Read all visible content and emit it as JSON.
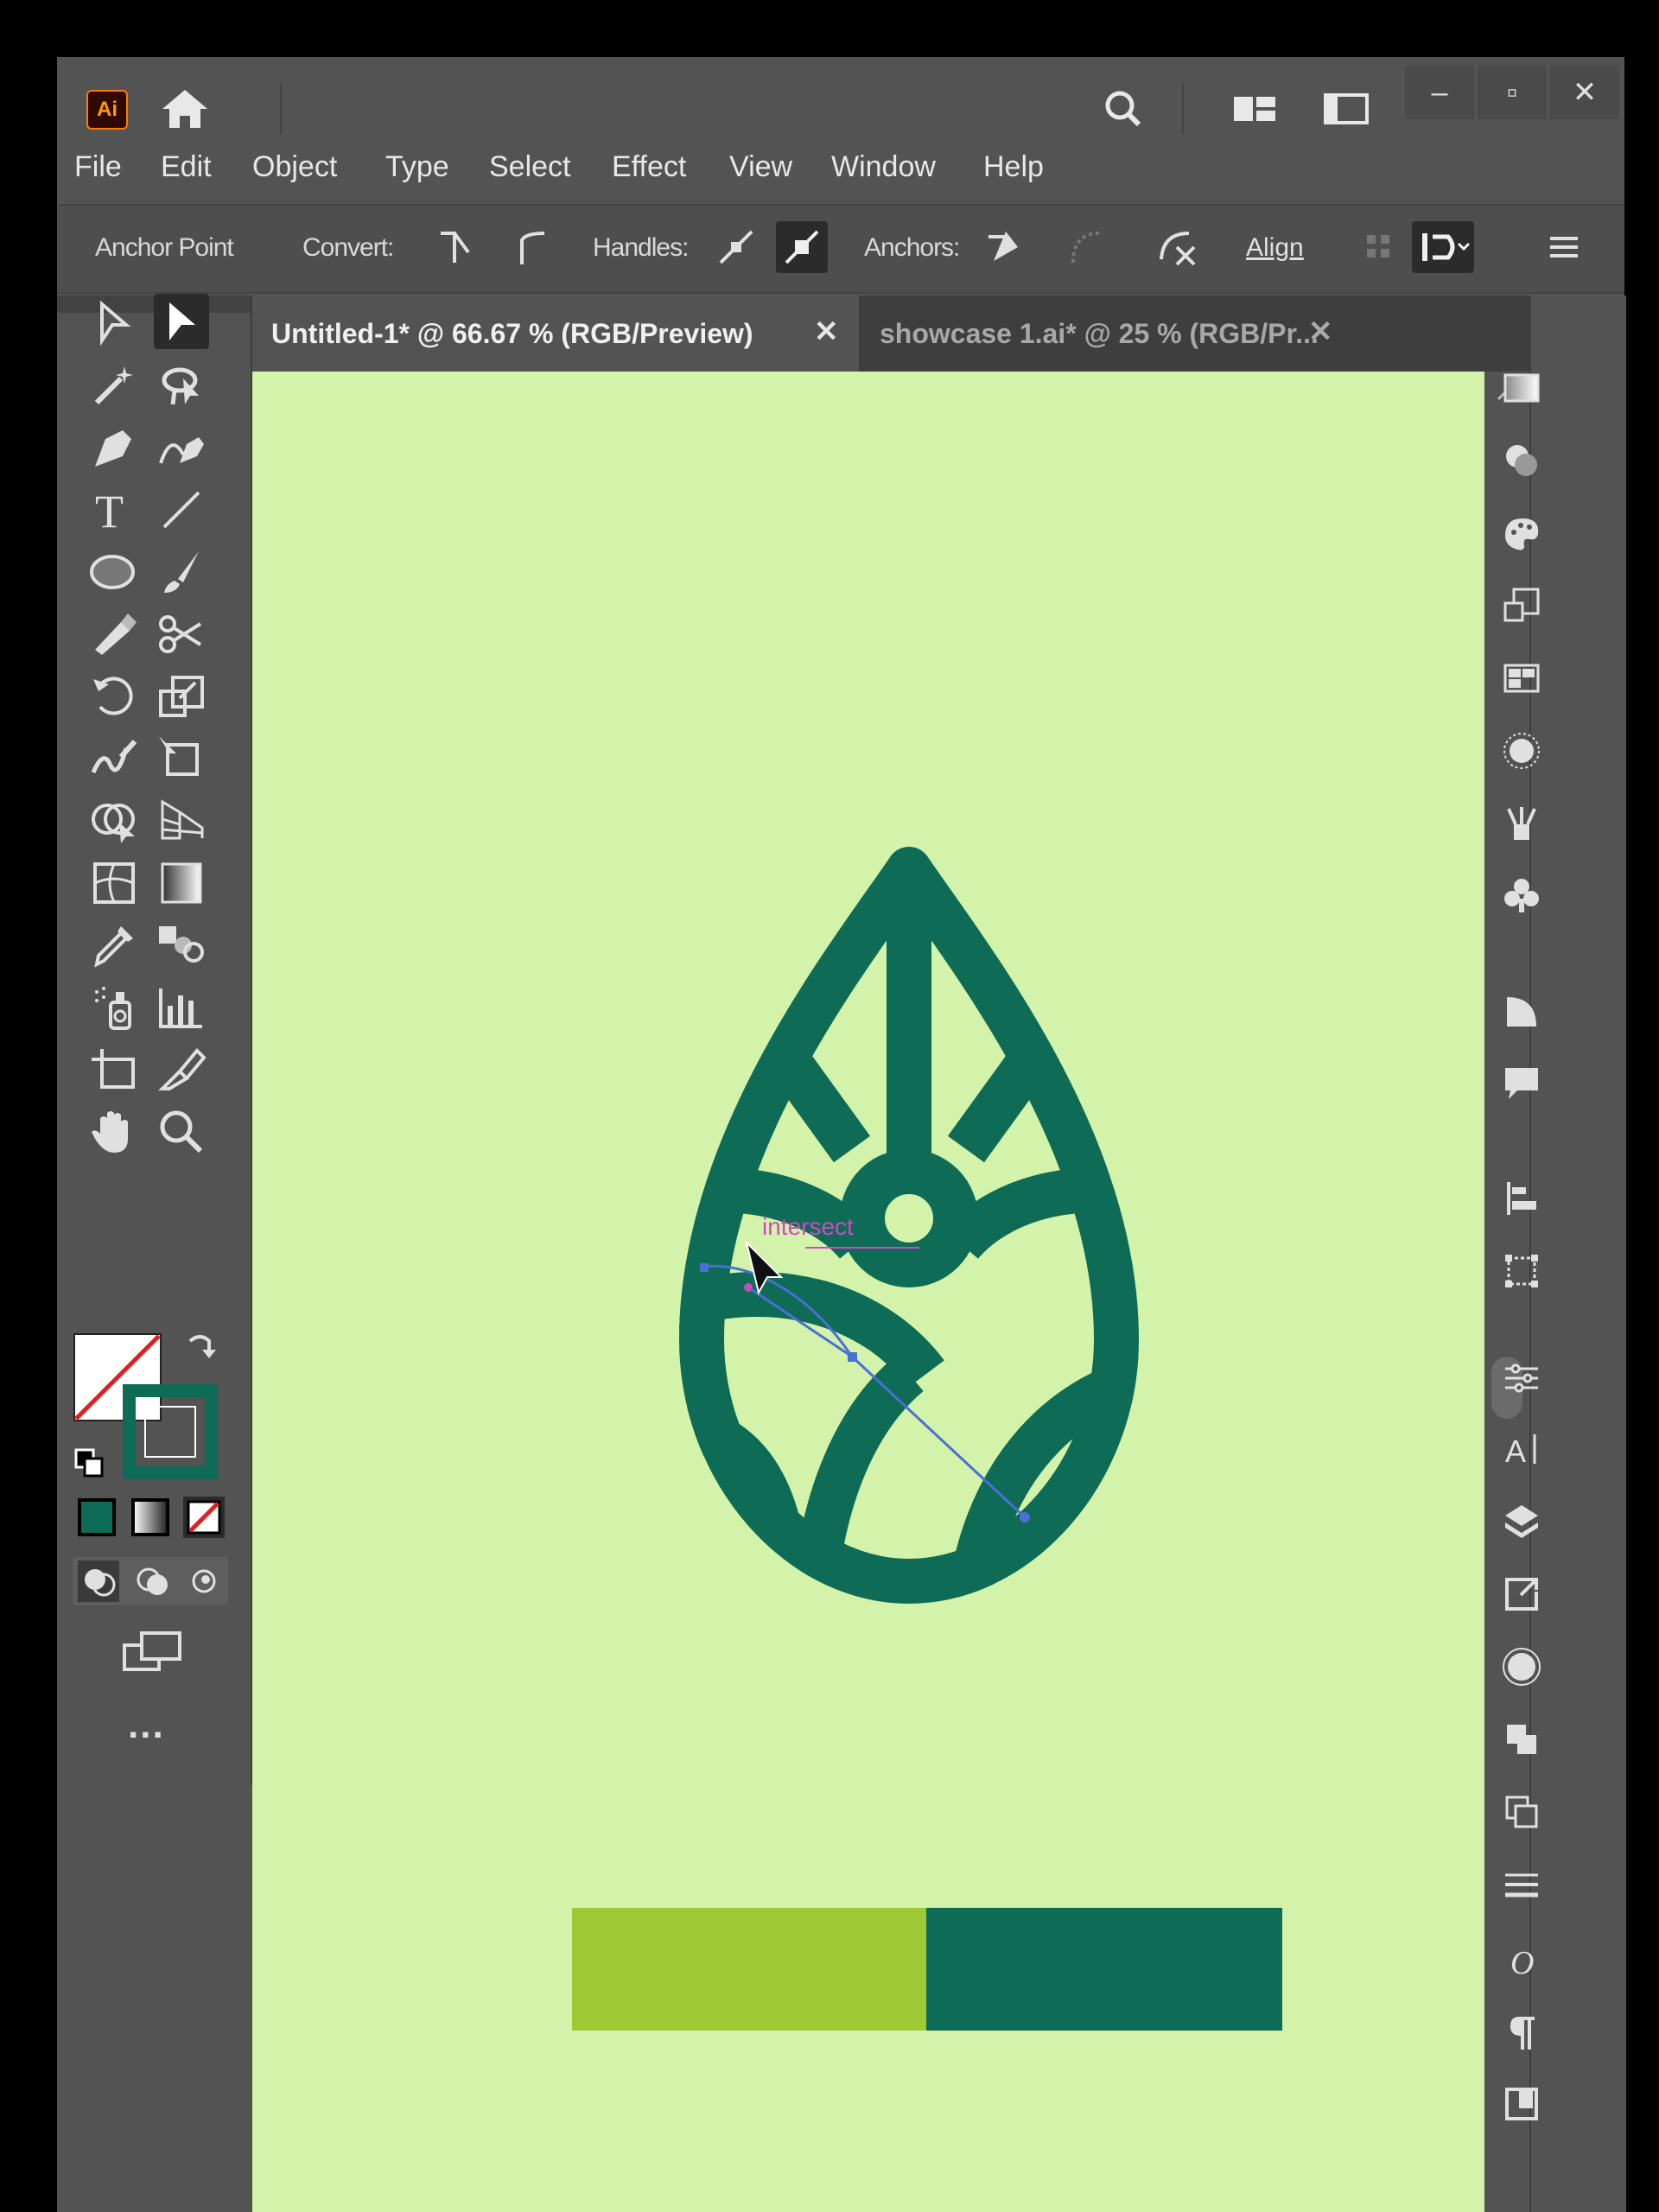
{
  "app": {
    "logo": "Ai"
  },
  "titlebar": {
    "icons": [
      "home-icon",
      "search-icon",
      "arrange-documents-icon",
      "workspace-icon"
    ],
    "window_controls": [
      "minimize",
      "maximize",
      "close"
    ]
  },
  "menu": [
    "File",
    "Edit",
    "Object",
    "Type",
    "Select",
    "Effect",
    "View",
    "Window",
    "Help"
  ],
  "control_bar": {
    "title": "Anchor Point",
    "convert_label": "Convert:",
    "handles_label": "Handles:",
    "anchors_label": "Anchors:",
    "align_label": "Align"
  },
  "tabs": [
    {
      "label": "Untitled-1* @ 66.67 % (RGB/Preview)",
      "active": true
    },
    {
      "label": "showcase 1.ai* @ 25 % (RGB/Pr...",
      "active": false
    }
  ],
  "canvas": {
    "smart_guide_label": "intersect",
    "artboard_color": "#d4f3aa",
    "logo_color": "#0e6b55",
    "swatches": [
      "#9dc935",
      "#0e6b55"
    ]
  },
  "toolbox": {
    "more_label": "...",
    "fill_swatch": "none",
    "stroke_color": "#0e6b55"
  }
}
